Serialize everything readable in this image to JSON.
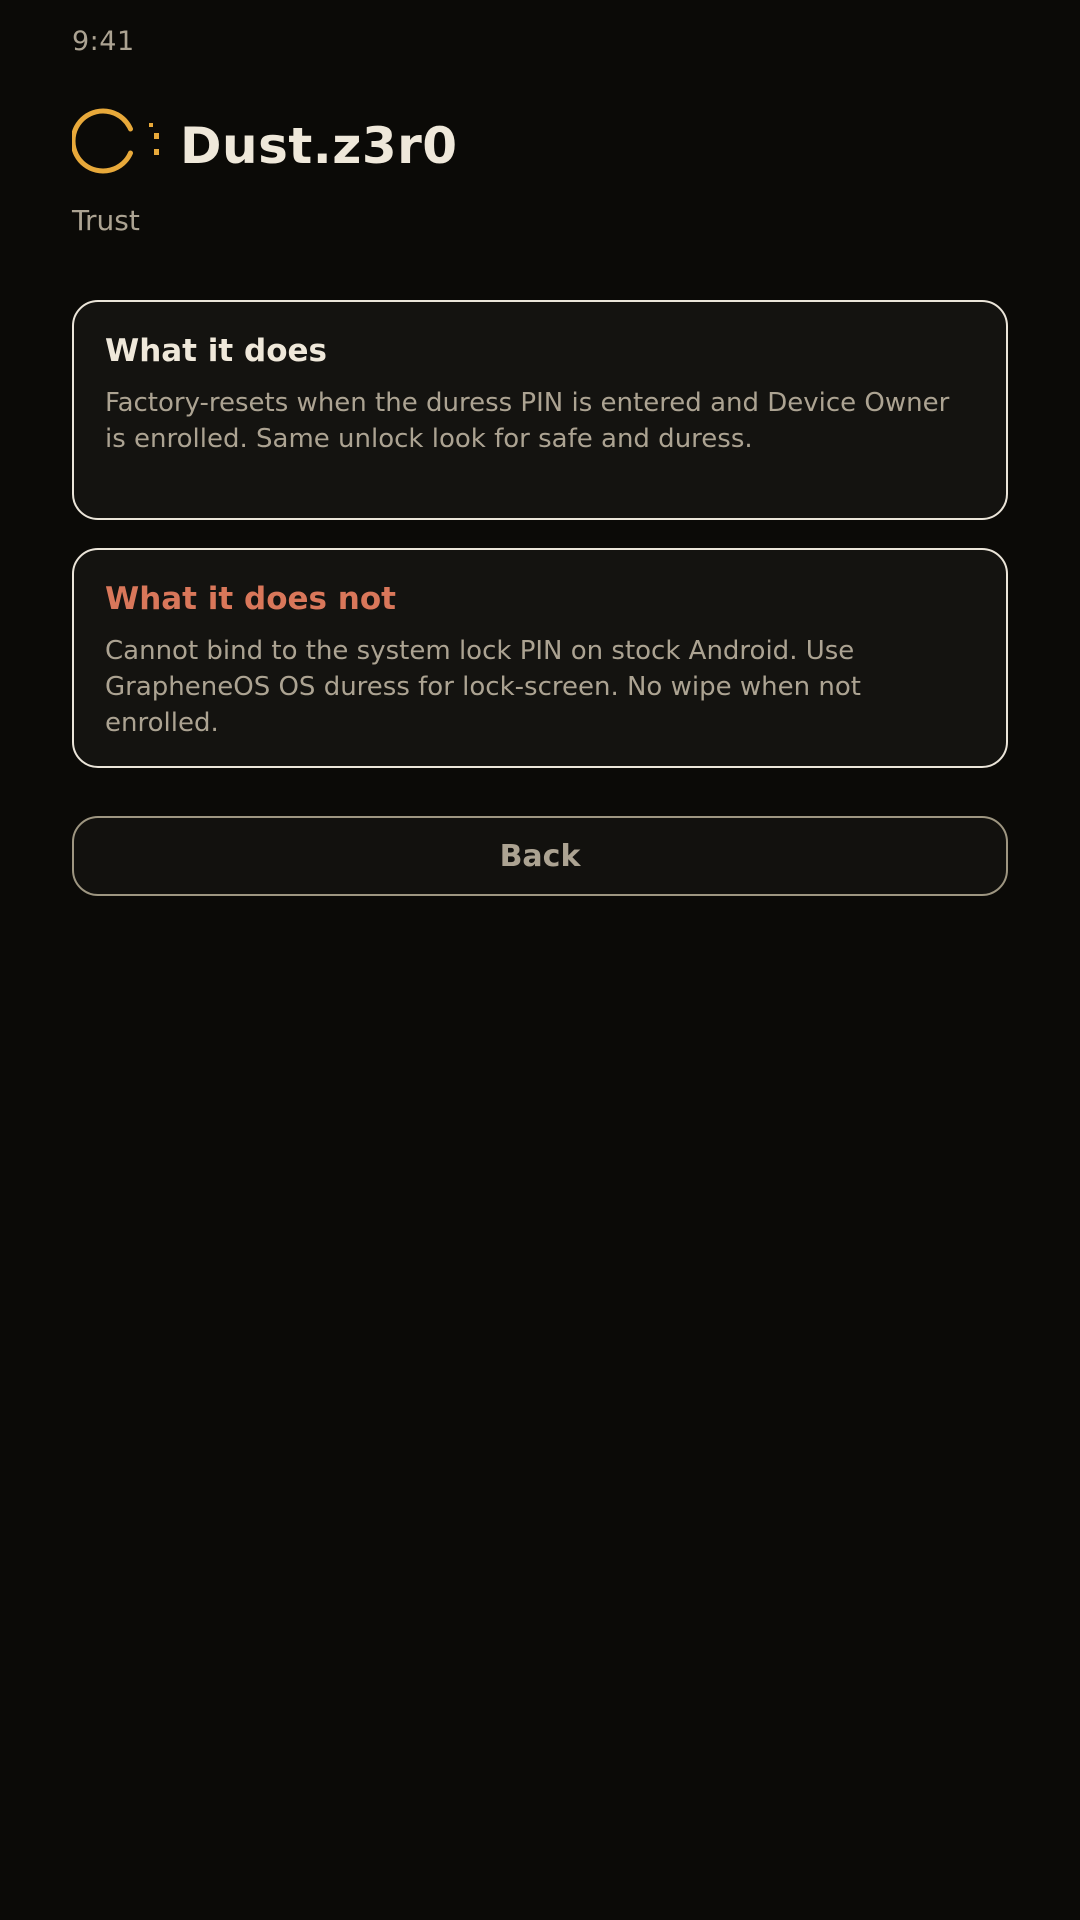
{
  "status_bar": {
    "time": "9:41"
  },
  "header": {
    "logo_icon": "dust-logo-icon",
    "app_name": "Dust.z3r0",
    "section": "Trust"
  },
  "cards": [
    {
      "title": "What it does",
      "body": "Factory-resets when the duress PIN is entered and Device Owner is enrolled. Same unlock look for safe and duress."
    },
    {
      "title": "What it does not",
      "body": "Cannot bind to the system lock PIN on stock Android. Use GrapheneOS OS duress for lock-screen. No wipe when not enrolled."
    }
  ],
  "actions": {
    "back_label": "Back"
  },
  "colors": {
    "background": "#0b0a07",
    "card_background": "#141310",
    "accent_gold": "#e8a93a",
    "warning_title": "#d9775a",
    "primary_text": "#efe8da",
    "secondary_text": "#aca392"
  }
}
